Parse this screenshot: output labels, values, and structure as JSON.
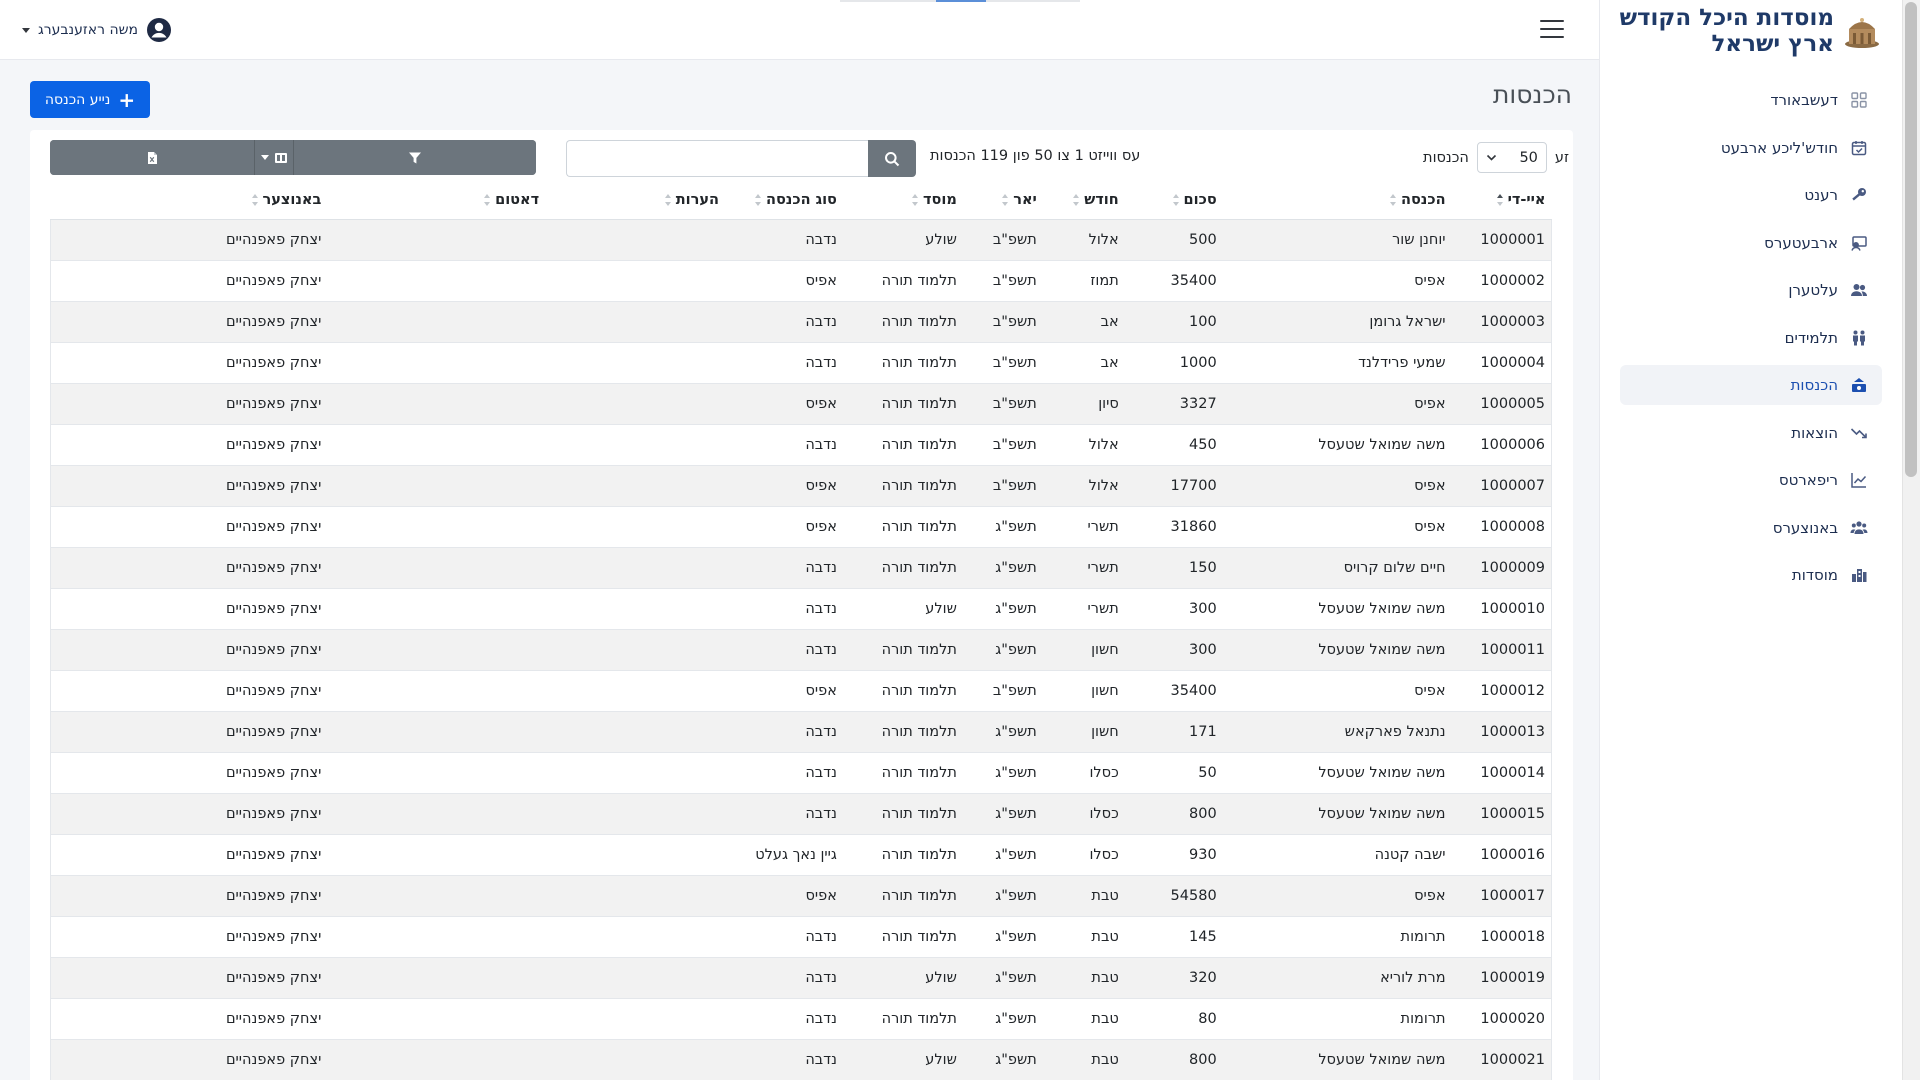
{
  "brand": {
    "line1": "מוסדות היכל הקודש",
    "line2": "ארץ ישראל"
  },
  "sidebar": {
    "items": [
      {
        "label": "דעשבאורד",
        "icon": "dashboard-icon"
      },
      {
        "label": "חודש'ליכע ארבעט",
        "icon": "calendar-check-icon"
      },
      {
        "label": "רענט",
        "icon": "key-icon"
      },
      {
        "label": "ארבעטערס",
        "icon": "worker-icon"
      },
      {
        "label": "עלטערן",
        "icon": "parents-icon"
      },
      {
        "label": "תלמידים",
        "icon": "students-icon"
      },
      {
        "label": "הכנסות",
        "icon": "income-icon",
        "active": true
      },
      {
        "label": "הוצאות",
        "icon": "trend-down-icon"
      },
      {
        "label": "ריפארטס",
        "icon": "line-chart-icon"
      },
      {
        "label": "באנוצערס",
        "icon": "users-group-icon"
      },
      {
        "label": "מוסדות",
        "icon": "institution-icon"
      }
    ]
  },
  "topbar": {
    "user_name": "משה ראזענבערג"
  },
  "page": {
    "title": "הכנסות",
    "add_button": "נייע הכנסה",
    "show_label_before": "זע",
    "page_length": "50",
    "show_label_after": "הכנסות",
    "info": "עס ווייזט 1 צו 50 פון 119 הכנסות",
    "search_placeholder": ""
  },
  "table": {
    "columns": [
      "איי-די",
      "הכנסה",
      "סכום",
      "חודש",
      "יאר",
      "מוסד",
      "סוג הכנסה",
      "הערות",
      "דאטום",
      "באנוצער"
    ],
    "rows": [
      [
        "1000001",
        "יוחנן שור",
        "500",
        "אלול",
        "תשפ\"ב",
        "שולע",
        "נדבה",
        "",
        "",
        "יצחק פאפנהיים"
      ],
      [
        "1000002",
        "אפיס",
        "35400",
        "תמוז",
        "תשפ\"ב",
        "תלמוד תורה",
        "אפיס",
        "",
        "",
        "יצחק פאפנהיים"
      ],
      [
        "1000003",
        "ישראל גרומן",
        "100",
        "אב",
        "תשפ\"ב",
        "תלמוד תורה",
        "נדבה",
        "",
        "",
        "יצחק פאפנהיים"
      ],
      [
        "1000004",
        "שמעי פרידלנד",
        "1000",
        "אב",
        "תשפ\"ב",
        "תלמוד תורה",
        "נדבה",
        "",
        "",
        "יצחק פאפנהיים"
      ],
      [
        "1000005",
        "אפיס",
        "3327",
        "סיון",
        "תשפ\"ב",
        "תלמוד תורה",
        "אפיס",
        "",
        "",
        "יצחק פאפנהיים"
      ],
      [
        "1000006",
        "משה שמואל שטעסל",
        "450",
        "אלול",
        "תשפ\"ב",
        "תלמוד תורה",
        "נדבה",
        "",
        "",
        "יצחק פאפנהיים"
      ],
      [
        "1000007",
        "אפיס",
        "17700",
        "אלול",
        "תשפ\"ב",
        "תלמוד תורה",
        "אפיס",
        "",
        "",
        "יצחק פאפנהיים"
      ],
      [
        "1000008",
        "אפיס",
        "31860",
        "תשרי",
        "תשפ\"ג",
        "תלמוד תורה",
        "אפיס",
        "",
        "",
        "יצחק פאפנהיים"
      ],
      [
        "1000009",
        "חיים שלום קרויס",
        "150",
        "תשרי",
        "תשפ\"ג",
        "תלמוד תורה",
        "נדבה",
        "",
        "",
        "יצחק פאפנהיים"
      ],
      [
        "1000010",
        "משה שמואל שטעסל",
        "300",
        "תשרי",
        "תשפ\"ג",
        "שולע",
        "נדבה",
        "",
        "",
        "יצחק פאפנהיים"
      ],
      [
        "1000011",
        "משה שמואל שטעסל",
        "300",
        "חשון",
        "תשפ\"ג",
        "תלמוד תורה",
        "נדבה",
        "",
        "",
        "יצחק פאפנהיים"
      ],
      [
        "1000012",
        "אפיס",
        "35400",
        "חשון",
        "תשפ\"ב",
        "תלמוד תורה",
        "אפיס",
        "",
        "",
        "יצחק פאפנהיים"
      ],
      [
        "1000013",
        "נתנאל פארקאש",
        "171",
        "חשון",
        "תשפ\"ג",
        "תלמוד תורה",
        "נדבה",
        "",
        "",
        "יצחק פאפנהיים"
      ],
      [
        "1000014",
        "משה שמואל שטעסל",
        "50",
        "כסלו",
        "תשפ\"ג",
        "תלמוד תורה",
        "נדבה",
        "",
        "",
        "יצחק פאפנהיים"
      ],
      [
        "1000015",
        "משה שמואל שטעסל",
        "800",
        "כסלו",
        "תשפ\"ג",
        "תלמוד תורה",
        "נדבה",
        "",
        "",
        "יצחק פאפנהיים"
      ],
      [
        "1000016",
        "ישבה קטנה",
        "930",
        "כסלו",
        "תשפ\"ג",
        "תלמוד תורה",
        "גיין נאך געלט",
        "",
        "",
        "יצחק פאפנהיים"
      ],
      [
        "1000017",
        "אפיס",
        "54580",
        "טבת",
        "תשפ\"ג",
        "תלמוד תורה",
        "אפיס",
        "",
        "",
        "יצחק פאפנהיים"
      ],
      [
        "1000018",
        "תרומות",
        "145",
        "טבת",
        "תשפ\"ג",
        "תלמוד תורה",
        "נדבה",
        "",
        "",
        "יצחק פאפנהיים"
      ],
      [
        "1000019",
        "מרת לוריא",
        "320",
        "טבת",
        "תשפ\"ג",
        "שולע",
        "נדבה",
        "",
        "",
        "יצחק פאפנהיים"
      ],
      [
        "1000020",
        "תרומות",
        "80",
        "טבת",
        "תשפ\"ג",
        "תלמוד תורה",
        "נדבה",
        "",
        "",
        "יצחק פאפנהיים"
      ],
      [
        "1000021",
        "משה שמואל שטעסל",
        "800",
        "טבת",
        "תשפ\"ג",
        "שולע",
        "נדבה",
        "",
        "",
        "יצחק פאפנהיים"
      ]
    ]
  },
  "colors": {
    "primary": "#0b63e5",
    "secondary": "#6c757d",
    "brand": "#1f3a68",
    "nav_text": "#1c2d4f"
  }
}
